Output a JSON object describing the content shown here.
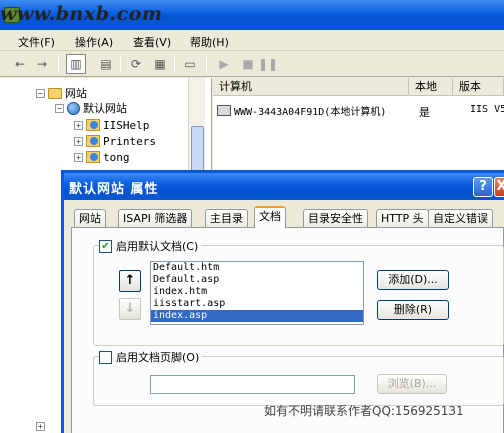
{
  "watermark": "www.bnxb.com",
  "menu": [
    {
      "label": "文件(F)"
    },
    {
      "label": "操作(A)"
    },
    {
      "label": "查看(V)"
    },
    {
      "label": "帮助(H)"
    }
  ],
  "toolbar_icons": [
    "back-icon",
    "forward-icon",
    "show-tree-icon",
    "properties-icon",
    "refresh-icon",
    "export-list-icon",
    "help-icon",
    "computer-icon",
    "play-icon",
    "stop-icon",
    "pause-icon"
  ],
  "tree": {
    "root": "网站",
    "site": "默认网站",
    "children": [
      "IISHelp",
      "Printers",
      "tong"
    ]
  },
  "detail": {
    "columns": [
      "计算机",
      "本地",
      "版本"
    ],
    "row": {
      "computer": "WWW-3443A04F91D(本地计算机)",
      "local": "是",
      "version": "IIS V5"
    }
  },
  "dialog": {
    "title": "默认网站 属性",
    "help_glyph": "?",
    "close_glyph": "X",
    "tabs": [
      "网站",
      "ISAPI 筛选器",
      "主目录",
      "文档",
      "目录安全性",
      "HTTP 头",
      "自定义错误"
    ],
    "active_tab": "文档",
    "enable_default_doc": {
      "label": "启用默认文档(C)",
      "checked": true
    },
    "move_up_glyph": "↑",
    "move_down_glyph": "↓",
    "default_docs": [
      "Default.htm",
      "Default.asp",
      "index.htm",
      "iisstart.asp",
      "index.asp"
    ],
    "selected_doc": "index.asp",
    "add_button": "添加(D)...",
    "remove_button": "删除(R)",
    "enable_footer": {
      "label": "启用文档页脚(O)",
      "checked": false
    },
    "footer_path": "",
    "browse_button": "浏览(B)..."
  },
  "footer_note": "如有不明请联系作者QQ:156925131"
}
